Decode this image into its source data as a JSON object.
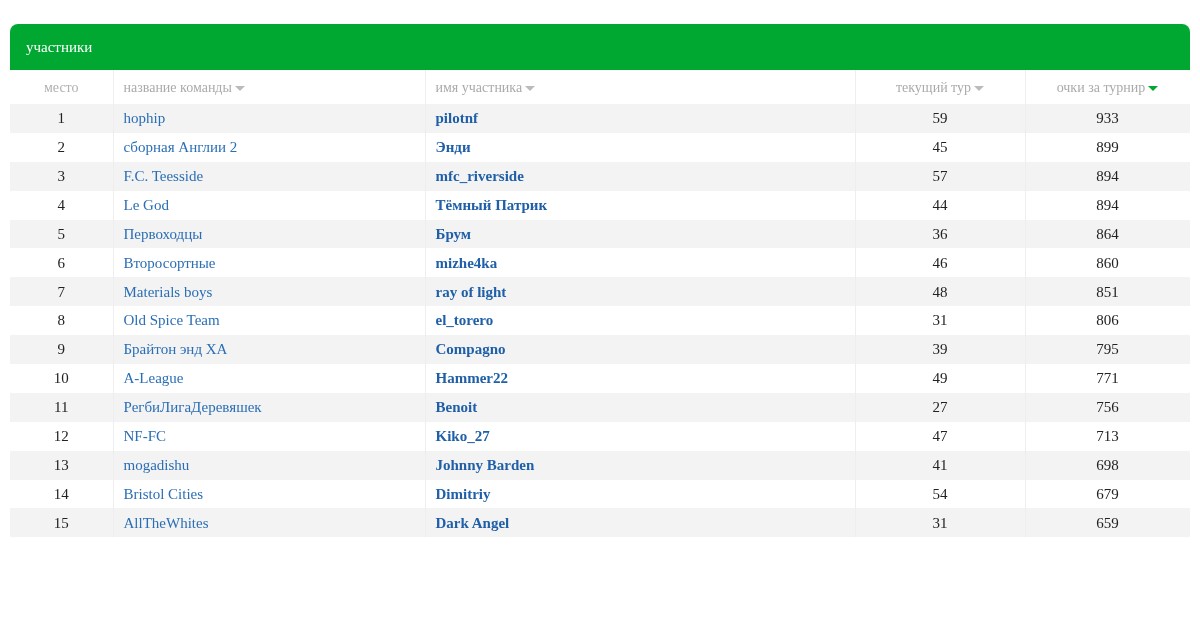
{
  "panel": {
    "title": "участники"
  },
  "columns": [
    {
      "label": "место",
      "sortable": false,
      "sorted": false
    },
    {
      "label": "название команды",
      "sortable": true,
      "sorted": false
    },
    {
      "label": "имя участника",
      "sortable": true,
      "sorted": false
    },
    {
      "label": "текущий тур",
      "sortable": true,
      "sorted": false
    },
    {
      "label": "очки за турнир",
      "sortable": true,
      "sorted": true
    }
  ],
  "rows": [
    {
      "place": "1",
      "team": "hophip",
      "player": "pilotnf",
      "current_round": "59",
      "points": "933"
    },
    {
      "place": "2",
      "team": "сборная Англии 2",
      "player": "Энди",
      "current_round": "45",
      "points": "899"
    },
    {
      "place": "3",
      "team": "F.C. Teesside",
      "player": "mfc_riverside",
      "current_round": "57",
      "points": "894"
    },
    {
      "place": "4",
      "team": "Le God",
      "player": "Тёмный Патрик",
      "current_round": "44",
      "points": "894"
    },
    {
      "place": "5",
      "team": "Первоходцы",
      "player": "Брум",
      "current_round": "36",
      "points": "864"
    },
    {
      "place": "6",
      "team": "Второсортные",
      "player": "mizhe4ka",
      "current_round": "46",
      "points": "860"
    },
    {
      "place": "7",
      "team": "Materials boys",
      "player": "ray of light",
      "current_round": "48",
      "points": "851"
    },
    {
      "place": "8",
      "team": "Old Spice Team",
      "player": "el_torero",
      "current_round": "31",
      "points": "806"
    },
    {
      "place": "9",
      "team": "Брайтон энд ХА",
      "player": "Compagno",
      "current_round": "39",
      "points": "795"
    },
    {
      "place": "10",
      "team": "A-League",
      "player": "Hammer22",
      "current_round": "49",
      "points": "771"
    },
    {
      "place": "11",
      "team": "РегбиЛигаДеревяшек",
      "player": "Benoit",
      "current_round": "27",
      "points": "756"
    },
    {
      "place": "12",
      "team": "NF-FC",
      "player": "Kiko_27",
      "current_round": "47",
      "points": "713"
    },
    {
      "place": "13",
      "team": "mogadishu",
      "player": "Johnny Barden",
      "current_round": "41",
      "points": "698"
    },
    {
      "place": "14",
      "team": "Bristol Cities",
      "player": "Dimitriy",
      "current_round": "54",
      "points": "679"
    },
    {
      "place": "15",
      "team": "AllTheWhites",
      "player": "Dark Angel",
      "current_round": "31",
      "points": "659"
    }
  ]
}
